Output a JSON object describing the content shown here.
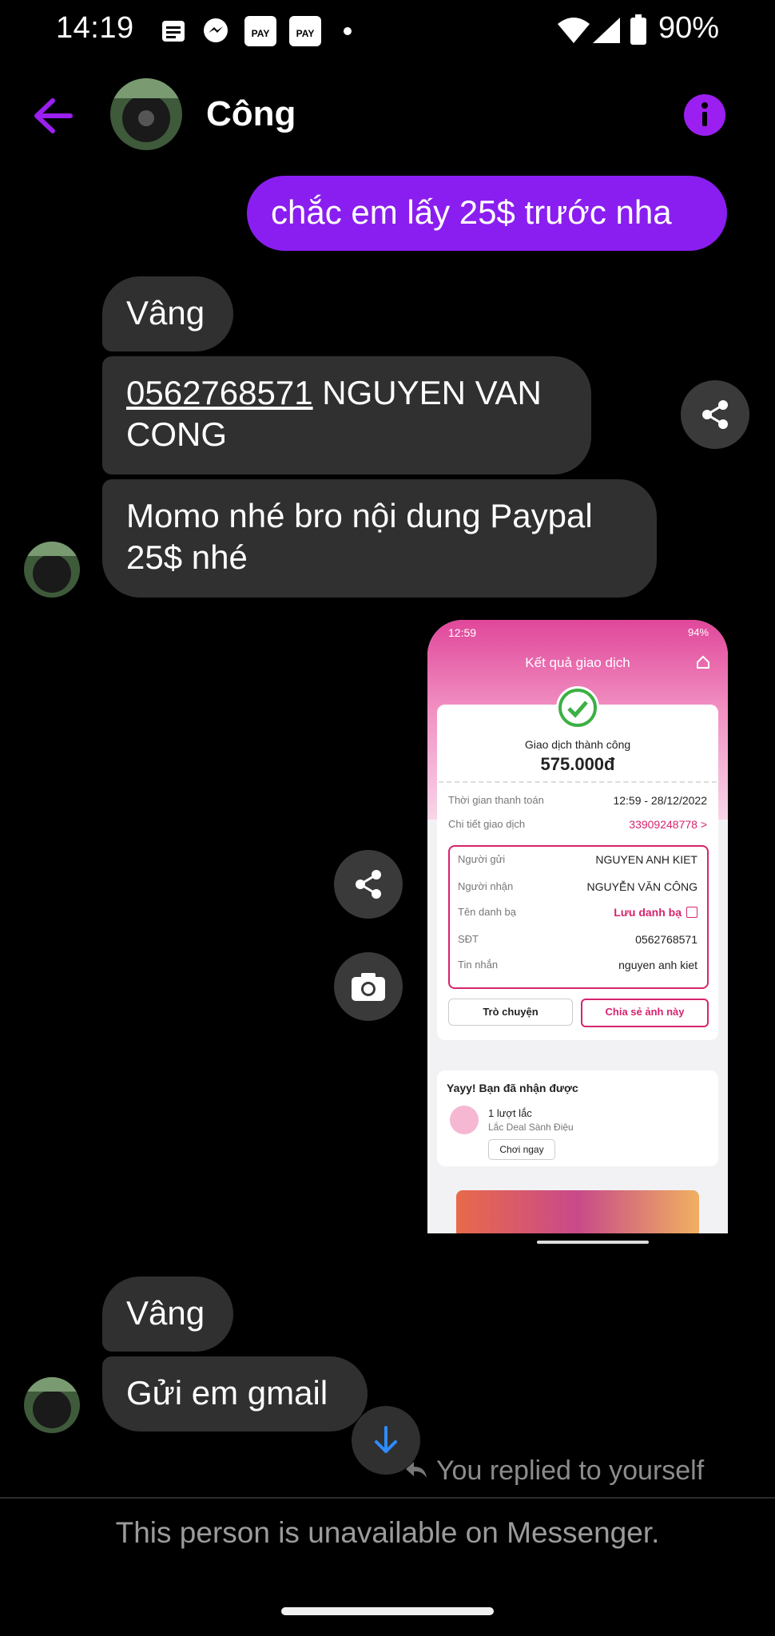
{
  "status_bar": {
    "time": "14:19",
    "battery": "90%",
    "icons": [
      "notes-icon",
      "messenger-icon",
      "pay-icon",
      "pay-icon",
      "dot-icon",
      "wifi-icon",
      "signal-icon",
      "battery-icon"
    ],
    "pay_label": "PAY"
  },
  "header": {
    "contact_name": "Công",
    "back_icon": "arrow-left-icon",
    "info_icon": "info-icon"
  },
  "messages": [
    {
      "from": "me",
      "text": "chắc em lấy 25$ trước nha"
    },
    {
      "from": "them",
      "text": "Vâng"
    },
    {
      "from": "them",
      "phone": "0562768571",
      "text": " NGUYEN VAN CONG"
    },
    {
      "from": "them",
      "text": "Momo nhé bro nội dung Paypal 25$ nhé"
    },
    {
      "from": "them",
      "text": "Vâng"
    },
    {
      "from": "them",
      "text": "Gửi em gmail"
    }
  ],
  "receipt": {
    "status_time": "12:59",
    "status_battery": "94%",
    "title": "Kết quả giao dịch",
    "success_text": "Giao dịch thành công",
    "amount": "575.000đ",
    "rows": [
      {
        "label": "Thời gian thanh toán",
        "value": "12:59 - 28/12/2022"
      },
      {
        "label": "Chi tiết giao dịch",
        "value": "33909248778 >"
      }
    ],
    "details": [
      {
        "label": "Người gửi",
        "value": "NGUYEN ANH KIET"
      },
      {
        "label": "Người nhận",
        "value": "NGUYỄN VĂN CÔNG"
      },
      {
        "label": "Tên danh bạ",
        "value": "Lưu danh bạ"
      },
      {
        "label": "SĐT",
        "value": "0562768571"
      },
      {
        "label": "Tin nhắn",
        "value": "nguyen anh kiet"
      }
    ],
    "chat_button": "Trò chuyện",
    "share_image_button": "Chia sẻ ảnh này",
    "promo_title": "Yayy! Bạn đã nhận được",
    "promo_item": "1 lượt lắc",
    "promo_sub": "Lắc Deal Sành Điệu",
    "promo_button": "Chơi ngay"
  },
  "reply_note": "You replied to yourself",
  "footer_text": "This person is unavailable on Messenger.",
  "colors": {
    "accent": "#8a1ef0",
    "bubble_them": "#303030",
    "momo_pink": "#d6246e"
  }
}
